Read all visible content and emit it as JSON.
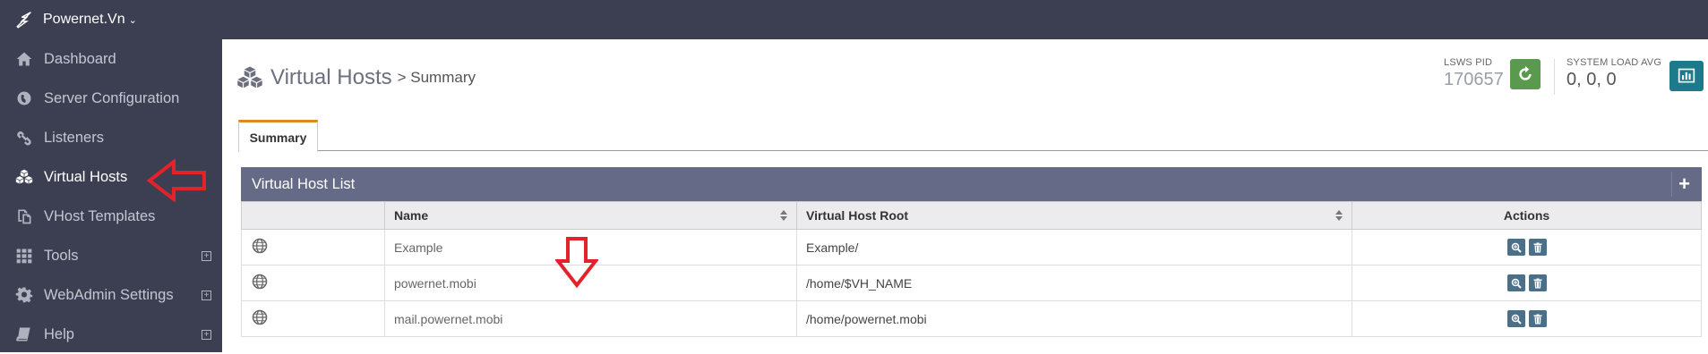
{
  "header": {
    "brand": "Powernet.Vn",
    "brand_caret": "⌄"
  },
  "sidebar": {
    "items": [
      {
        "label": "Dashboard",
        "icon": "home-icon"
      },
      {
        "label": "Server Configuration",
        "icon": "globe-icon"
      },
      {
        "label": "Listeners",
        "icon": "link-icon"
      },
      {
        "label": "Virtual Hosts",
        "icon": "cubes-icon",
        "active": true
      },
      {
        "label": "VHost Templates",
        "icon": "copy-icon"
      },
      {
        "label": "Tools",
        "icon": "grid-icon",
        "expand": "+"
      },
      {
        "label": "WebAdmin Settings",
        "icon": "gear-icon",
        "expand": "+"
      },
      {
        "label": "Help",
        "icon": "book-icon",
        "expand": "+"
      }
    ]
  },
  "page": {
    "title": "Virtual Hosts",
    "crumb": "> Summary"
  },
  "stats": {
    "pid_label": "LSWS PID",
    "pid_value": "170657",
    "load_label": "SYSTEM LOAD AVG",
    "load_value": "0, 0, 0"
  },
  "tabs": [
    {
      "label": "Summary",
      "active": true
    }
  ],
  "panel": {
    "title": "Virtual Host List",
    "add_label": "+",
    "columns": [
      "Name",
      "Virtual Host Root",
      "Actions"
    ],
    "rows": [
      {
        "name": "Example",
        "root": "Example/"
      },
      {
        "name": "powernet.mobi",
        "root": "/home/$VH_NAME"
      },
      {
        "name": "mail.powernet.mobi",
        "root": "/home/powernet.mobi"
      }
    ]
  },
  "colors": {
    "sidebar": "#3b3f51",
    "panel_head": "#656b86",
    "tab_accent": "#e08a1e",
    "annotation_arrow": "#e4222a"
  }
}
